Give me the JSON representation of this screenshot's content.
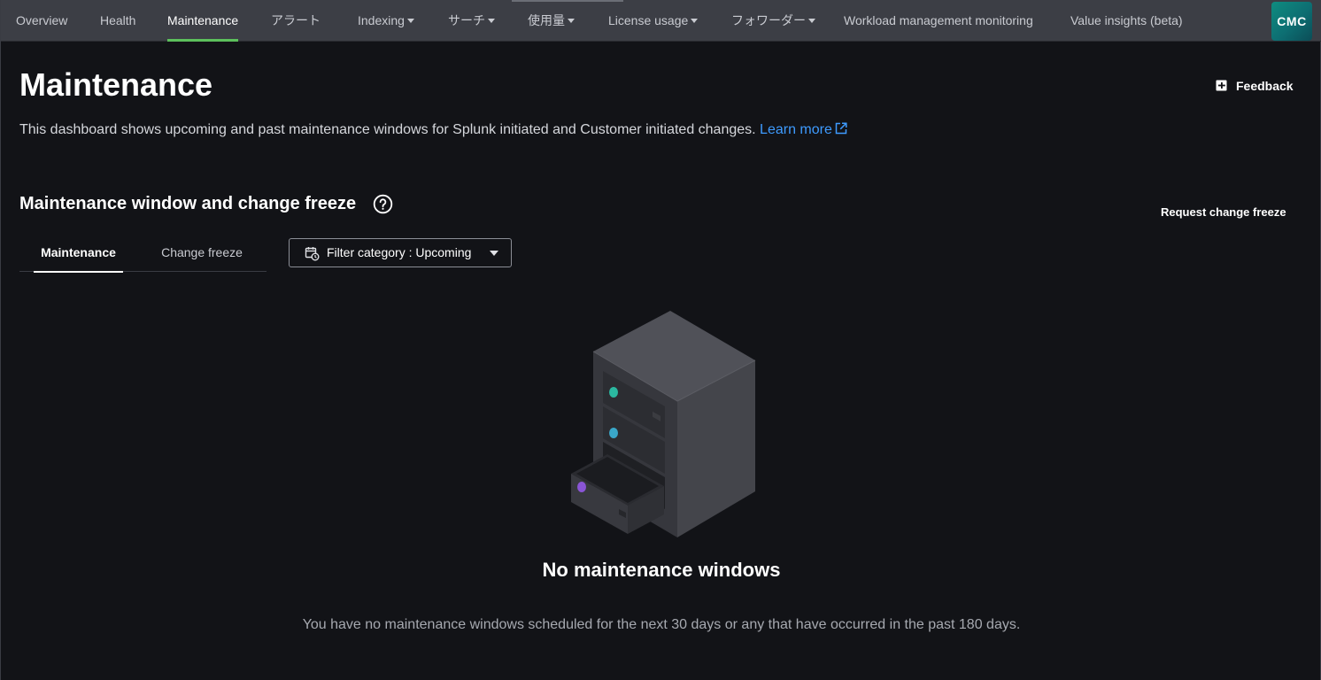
{
  "nav": {
    "items": [
      {
        "label": "Overview",
        "dropdown": false
      },
      {
        "label": "Health",
        "dropdown": false
      },
      {
        "label": "Maintenance",
        "dropdown": false,
        "active": true
      },
      {
        "label": "アラート",
        "dropdown": false
      },
      {
        "label": "Indexing",
        "dropdown": true
      },
      {
        "label": "サーチ",
        "dropdown": true
      },
      {
        "label": "使用量",
        "dropdown": true
      },
      {
        "label": "License usage",
        "dropdown": true
      },
      {
        "label": "フォワーダー",
        "dropdown": true
      },
      {
        "label": "Workload management monitoring",
        "dropdown": false
      },
      {
        "label": "Value insights (beta)",
        "dropdown": false
      }
    ],
    "app_badge": "CMC"
  },
  "header": {
    "title": "Maintenance",
    "feedback_label": "Feedback",
    "description": "This dashboard shows upcoming and past maintenance windows for Splunk initiated and Customer initiated changes. ",
    "learn_more": "Learn more"
  },
  "section": {
    "title": "Maintenance window and change freeze",
    "request_change_freeze": "Request change freeze",
    "tabs": [
      {
        "label": "Maintenance",
        "active": true
      },
      {
        "label": "Change freeze",
        "active": false
      }
    ],
    "filter_label": "Filter category : Upcoming"
  },
  "empty_state": {
    "title": "No maintenance windows",
    "message": "You have no maintenance windows scheduled for the next 30 days or any that have occurred in the past 180 days."
  },
  "colors": {
    "background": "#121317",
    "nav_background": "#3c3e45",
    "active_tab_indicator": "#5cc05c",
    "link": "#3e9bff",
    "app_badge": "#0f8c80",
    "server_led_1": "#2bb8a0",
    "server_led_2": "#3aa7c9",
    "server_led_3": "#8a55d6"
  },
  "icons": {
    "feedback": "feedback-plus-icon",
    "learn_more": "external-link-icon",
    "help": "question-circle-icon",
    "filter": "calendar-filter-icon",
    "illustration": "server-rack-illustration"
  }
}
